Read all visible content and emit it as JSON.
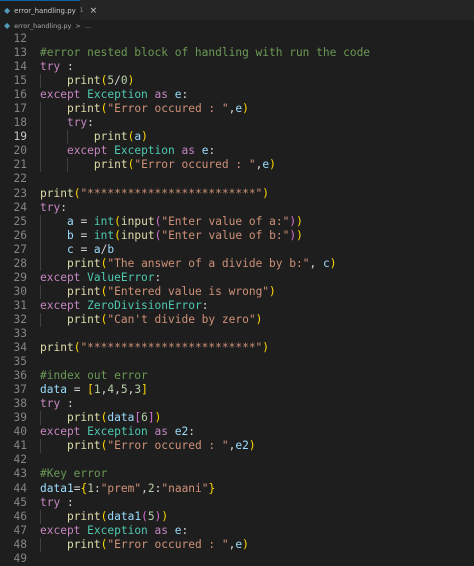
{
  "tab": {
    "filename": "error_handling.py",
    "modified": "1",
    "close_icon": "×"
  },
  "breadcrumb": {
    "file": "error_handling.py",
    "separator": ">",
    "ellipsis": "..."
  },
  "editor": {
    "active_line": "19",
    "lines": [
      {
        "n": "12",
        "tokens": []
      },
      {
        "n": "13",
        "tokens": [
          {
            "t": "#error nested block of handling with run the code",
            "c": "cmt"
          }
        ]
      },
      {
        "n": "14",
        "tokens": [
          {
            "t": "try",
            "c": "kw"
          },
          {
            "t": " :",
            "c": "op"
          }
        ]
      },
      {
        "n": "15",
        "tokens": [
          {
            "t": "    ",
            "c": "op"
          },
          {
            "t": "print",
            "c": "fn"
          },
          {
            "t": "(",
            "c": "br1"
          },
          {
            "t": "5",
            "c": "num"
          },
          {
            "t": "/",
            "c": "op"
          },
          {
            "t": "0",
            "c": "num"
          },
          {
            "t": ")",
            "c": "br1"
          }
        ]
      },
      {
        "n": "16",
        "tokens": [
          {
            "t": "except",
            "c": "kw"
          },
          {
            "t": " ",
            "c": "op"
          },
          {
            "t": "Exception",
            "c": "cls"
          },
          {
            "t": " ",
            "c": "op"
          },
          {
            "t": "as",
            "c": "kw"
          },
          {
            "t": " ",
            "c": "op"
          },
          {
            "t": "e",
            "c": "var"
          },
          {
            "t": ":",
            "c": "op"
          }
        ]
      },
      {
        "n": "17",
        "tokens": [
          {
            "t": "    ",
            "c": "op"
          },
          {
            "t": "print",
            "c": "fn"
          },
          {
            "t": "(",
            "c": "br1"
          },
          {
            "t": "\"Error occured : \"",
            "c": "str"
          },
          {
            "t": ",",
            "c": "op"
          },
          {
            "t": "e",
            "c": "var"
          },
          {
            "t": ")",
            "c": "br1"
          }
        ]
      },
      {
        "n": "18",
        "tokens": [
          {
            "t": "    ",
            "c": "op"
          },
          {
            "t": "try",
            "c": "kw"
          },
          {
            "t": ":",
            "c": "op"
          }
        ]
      },
      {
        "n": "19",
        "tokens": [
          {
            "t": "        ",
            "c": "op"
          },
          {
            "t": "print",
            "c": "fn"
          },
          {
            "t": "(",
            "c": "br1"
          },
          {
            "t": "a",
            "c": "var"
          },
          {
            "t": ")",
            "c": "br1"
          }
        ]
      },
      {
        "n": "20",
        "tokens": [
          {
            "t": "    ",
            "c": "op"
          },
          {
            "t": "except",
            "c": "kw"
          },
          {
            "t": " ",
            "c": "op"
          },
          {
            "t": "Exception",
            "c": "cls"
          },
          {
            "t": " ",
            "c": "op"
          },
          {
            "t": "as",
            "c": "kw"
          },
          {
            "t": " ",
            "c": "op"
          },
          {
            "t": "e",
            "c": "var"
          },
          {
            "t": ":",
            "c": "op"
          }
        ]
      },
      {
        "n": "21",
        "tokens": [
          {
            "t": "        ",
            "c": "op"
          },
          {
            "t": "print",
            "c": "fn"
          },
          {
            "t": "(",
            "c": "br1"
          },
          {
            "t": "\"Error occured : \"",
            "c": "str"
          },
          {
            "t": ",",
            "c": "op"
          },
          {
            "t": "e",
            "c": "var"
          },
          {
            "t": ")",
            "c": "br1"
          }
        ]
      },
      {
        "n": "22",
        "tokens": []
      },
      {
        "n": "23",
        "tokens": [
          {
            "t": "print",
            "c": "fn"
          },
          {
            "t": "(",
            "c": "br1"
          },
          {
            "t": "\"*************************\"",
            "c": "str"
          },
          {
            "t": ")",
            "c": "br1"
          }
        ]
      },
      {
        "n": "24",
        "tokens": [
          {
            "t": "try",
            "c": "kw"
          },
          {
            "t": ":",
            "c": "op"
          }
        ]
      },
      {
        "n": "25",
        "tokens": [
          {
            "t": "    ",
            "c": "op"
          },
          {
            "t": "a",
            "c": "var"
          },
          {
            "t": " = ",
            "c": "op"
          },
          {
            "t": "int",
            "c": "cls"
          },
          {
            "t": "(",
            "c": "br1"
          },
          {
            "t": "input",
            "c": "fn"
          },
          {
            "t": "(",
            "c": "br2"
          },
          {
            "t": "\"Enter value of a:\"",
            "c": "str"
          },
          {
            "t": ")",
            "c": "br2"
          },
          {
            "t": ")",
            "c": "br1"
          }
        ]
      },
      {
        "n": "26",
        "tokens": [
          {
            "t": "    ",
            "c": "op"
          },
          {
            "t": "b",
            "c": "var"
          },
          {
            "t": " = ",
            "c": "op"
          },
          {
            "t": "int",
            "c": "cls"
          },
          {
            "t": "(",
            "c": "br1"
          },
          {
            "t": "input",
            "c": "fn"
          },
          {
            "t": "(",
            "c": "br2"
          },
          {
            "t": "\"Enter value of b:\"",
            "c": "str"
          },
          {
            "t": ")",
            "c": "br2"
          },
          {
            "t": ")",
            "c": "br1"
          }
        ]
      },
      {
        "n": "27",
        "tokens": [
          {
            "t": "    ",
            "c": "op"
          },
          {
            "t": "c",
            "c": "var"
          },
          {
            "t": " = ",
            "c": "op"
          },
          {
            "t": "a",
            "c": "var"
          },
          {
            "t": "/",
            "c": "op"
          },
          {
            "t": "b",
            "c": "var"
          }
        ]
      },
      {
        "n": "28",
        "tokens": [
          {
            "t": "    ",
            "c": "op"
          },
          {
            "t": "print",
            "c": "fn"
          },
          {
            "t": "(",
            "c": "br1"
          },
          {
            "t": "\"The answer of a divide by b:\"",
            "c": "str"
          },
          {
            "t": ", ",
            "c": "op"
          },
          {
            "t": "c",
            "c": "var"
          },
          {
            "t": ")",
            "c": "br1"
          }
        ]
      },
      {
        "n": "29",
        "tokens": [
          {
            "t": "except",
            "c": "kw"
          },
          {
            "t": " ",
            "c": "op"
          },
          {
            "t": "ValueError",
            "c": "cls"
          },
          {
            "t": ":",
            "c": "op"
          }
        ]
      },
      {
        "n": "30",
        "tokens": [
          {
            "t": "    ",
            "c": "op"
          },
          {
            "t": "print",
            "c": "fn"
          },
          {
            "t": "(",
            "c": "br1"
          },
          {
            "t": "\"Entered value is wrong\"",
            "c": "str"
          },
          {
            "t": ")",
            "c": "br1"
          }
        ]
      },
      {
        "n": "31",
        "tokens": [
          {
            "t": "except",
            "c": "kw"
          },
          {
            "t": " ",
            "c": "op"
          },
          {
            "t": "ZeroDivisionError",
            "c": "cls"
          },
          {
            "t": ":",
            "c": "op"
          }
        ]
      },
      {
        "n": "32",
        "tokens": [
          {
            "t": "    ",
            "c": "op"
          },
          {
            "t": "print",
            "c": "fn"
          },
          {
            "t": "(",
            "c": "br1"
          },
          {
            "t": "\"Can't divide by zero\"",
            "c": "str"
          },
          {
            "t": ")",
            "c": "br1"
          }
        ]
      },
      {
        "n": "33",
        "tokens": []
      },
      {
        "n": "34",
        "tokens": [
          {
            "t": "print",
            "c": "fn"
          },
          {
            "t": "(",
            "c": "br1"
          },
          {
            "t": "\"*************************\"",
            "c": "str"
          },
          {
            "t": ")",
            "c": "br1"
          }
        ]
      },
      {
        "n": "35",
        "tokens": []
      },
      {
        "n": "36",
        "tokens": [
          {
            "t": "#index out error",
            "c": "cmt"
          }
        ]
      },
      {
        "n": "37",
        "tokens": [
          {
            "t": "data",
            "c": "var"
          },
          {
            "t": " = ",
            "c": "op"
          },
          {
            "t": "[",
            "c": "br1"
          },
          {
            "t": "1",
            "c": "num"
          },
          {
            "t": ",",
            "c": "op"
          },
          {
            "t": "4",
            "c": "num"
          },
          {
            "t": ",",
            "c": "op"
          },
          {
            "t": "5",
            "c": "num"
          },
          {
            "t": ",",
            "c": "op"
          },
          {
            "t": "3",
            "c": "num"
          },
          {
            "t": "]",
            "c": "br1"
          }
        ]
      },
      {
        "n": "38",
        "tokens": [
          {
            "t": "try",
            "c": "kw"
          },
          {
            "t": " :",
            "c": "op"
          }
        ]
      },
      {
        "n": "39",
        "tokens": [
          {
            "t": "    ",
            "c": "op"
          },
          {
            "t": "print",
            "c": "fn"
          },
          {
            "t": "(",
            "c": "br1"
          },
          {
            "t": "data",
            "c": "var"
          },
          {
            "t": "[",
            "c": "br2"
          },
          {
            "t": "6",
            "c": "num"
          },
          {
            "t": "]",
            "c": "br2"
          },
          {
            "t": ")",
            "c": "br1"
          }
        ]
      },
      {
        "n": "40",
        "tokens": [
          {
            "t": "except",
            "c": "kw"
          },
          {
            "t": " ",
            "c": "op"
          },
          {
            "t": "Exception",
            "c": "cls"
          },
          {
            "t": " ",
            "c": "op"
          },
          {
            "t": "as",
            "c": "kw"
          },
          {
            "t": " ",
            "c": "op"
          },
          {
            "t": "e2",
            "c": "var"
          },
          {
            "t": ":",
            "c": "op"
          }
        ]
      },
      {
        "n": "41",
        "tokens": [
          {
            "t": "    ",
            "c": "op"
          },
          {
            "t": "print",
            "c": "fn"
          },
          {
            "t": "(",
            "c": "br1"
          },
          {
            "t": "\"Error occured : \"",
            "c": "str"
          },
          {
            "t": ",",
            "c": "op"
          },
          {
            "t": "e2",
            "c": "var"
          },
          {
            "t": ")",
            "c": "br1"
          }
        ]
      },
      {
        "n": "42",
        "tokens": []
      },
      {
        "n": "43",
        "tokens": [
          {
            "t": "#Key error",
            "c": "cmt"
          }
        ]
      },
      {
        "n": "44",
        "tokens": [
          {
            "t": "data1",
            "c": "var"
          },
          {
            "t": "=",
            "c": "op"
          },
          {
            "t": "{",
            "c": "br1"
          },
          {
            "t": "1",
            "c": "num"
          },
          {
            "t": ":",
            "c": "op"
          },
          {
            "t": "\"prem\"",
            "c": "str"
          },
          {
            "t": ",",
            "c": "op"
          },
          {
            "t": "2",
            "c": "num"
          },
          {
            "t": ":",
            "c": "op"
          },
          {
            "t": "\"naani\"",
            "c": "str"
          },
          {
            "t": "}",
            "c": "br1"
          }
        ]
      },
      {
        "n": "45",
        "tokens": [
          {
            "t": "try",
            "c": "kw"
          },
          {
            "t": " :",
            "c": "op"
          }
        ]
      },
      {
        "n": "46",
        "tokens": [
          {
            "t": "    ",
            "c": "op"
          },
          {
            "t": "print",
            "c": "fn"
          },
          {
            "t": "(",
            "c": "br1"
          },
          {
            "t": "data1",
            "c": "var"
          },
          {
            "t": "(",
            "c": "br2"
          },
          {
            "t": "5",
            "c": "num"
          },
          {
            "t": ")",
            "c": "br2"
          },
          {
            "t": ")",
            "c": "br1"
          }
        ]
      },
      {
        "n": "47",
        "tokens": [
          {
            "t": "except",
            "c": "kw"
          },
          {
            "t": " ",
            "c": "op"
          },
          {
            "t": "Exception",
            "c": "cls"
          },
          {
            "t": " ",
            "c": "op"
          },
          {
            "t": "as",
            "c": "kw"
          },
          {
            "t": " ",
            "c": "op"
          },
          {
            "t": "e",
            "c": "var"
          },
          {
            "t": ":",
            "c": "op"
          }
        ]
      },
      {
        "n": "48",
        "tokens": [
          {
            "t": "    ",
            "c": "op"
          },
          {
            "t": "print",
            "c": "fn"
          },
          {
            "t": "(",
            "c": "br1"
          },
          {
            "t": "\"Error occured : \"",
            "c": "str"
          },
          {
            "t": ",",
            "c": "op"
          },
          {
            "t": "e",
            "c": "var"
          },
          {
            "t": ")",
            "c": "br1"
          }
        ]
      },
      {
        "n": "49",
        "tokens": []
      }
    ]
  }
}
